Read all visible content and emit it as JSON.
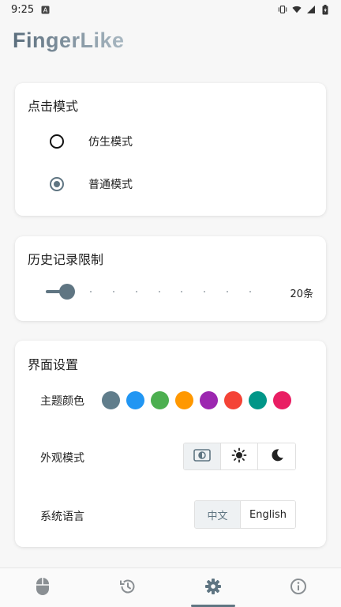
{
  "status_bar": {
    "time": "9:25",
    "left_icons": [
      "notification-a-icon"
    ],
    "right_icons": [
      "vibrate-icon",
      "wifi-icon",
      "signal-icon",
      "battery-icon"
    ]
  },
  "app": {
    "title": "FingerLike"
  },
  "click_mode": {
    "title": "点击模式",
    "options": [
      {
        "label": "仿生模式",
        "selected": false
      },
      {
        "label": "普通模式",
        "selected": true
      }
    ]
  },
  "history_limit": {
    "title": "历史记录限制",
    "value_label": "20条",
    "level_fraction": 0.1,
    "tick_count": 8
  },
  "ui_settings": {
    "title": "界面设置",
    "theme_color": {
      "label": "主题颜色",
      "colors": [
        "#607d8b",
        "#2196f3",
        "#4caf50",
        "#ff9800",
        "#9c27b0",
        "#f44336",
        "#009688",
        "#e91e63"
      ]
    },
    "appearance": {
      "label": "外观模式",
      "options": [
        "auto-theme-icon",
        "light-mode-icon",
        "dark-mode-icon"
      ],
      "selected_index": 0
    },
    "language": {
      "label": "系统语言",
      "options": [
        "中文",
        "English"
      ],
      "selected_index": 0
    }
  },
  "bottom_nav": {
    "items": [
      "mouse-icon",
      "history-icon",
      "settings-icon",
      "info-icon"
    ],
    "active_index": 2
  },
  "colors": {
    "accent": "#5f7582"
  }
}
